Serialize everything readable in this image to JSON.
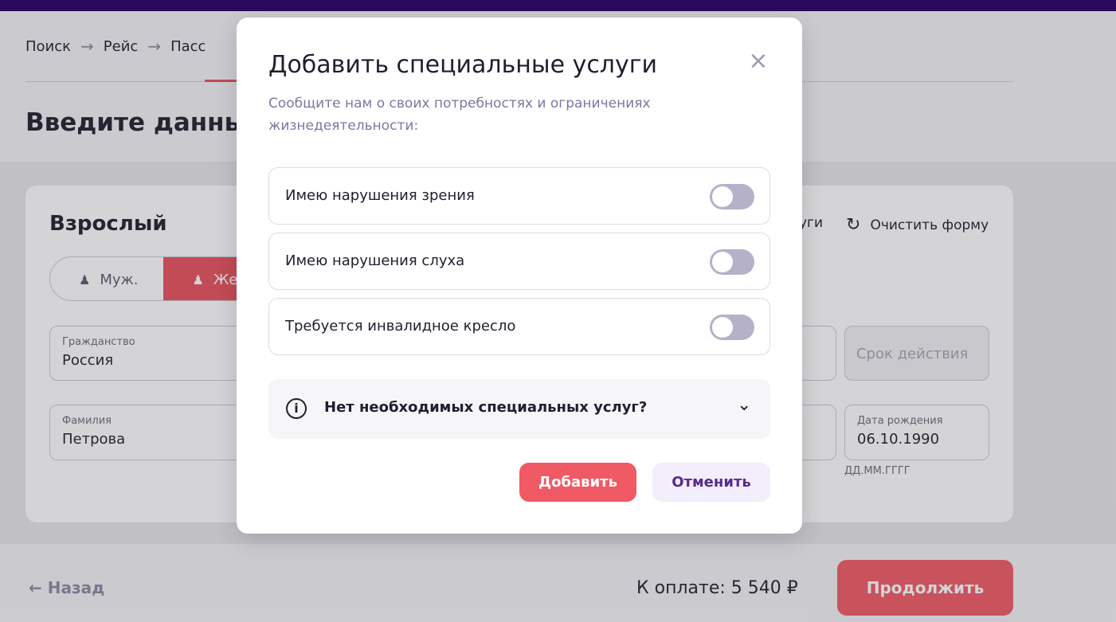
{
  "breadcrumb": {
    "step1": "Поиск",
    "step2": "Рейс",
    "step3": "Пасс",
    "arrow": "→"
  },
  "page": {
    "title": "Введите данные"
  },
  "passenger": {
    "title": "Взрослый",
    "gender": {
      "male": "Муж.",
      "female": "Же"
    },
    "actions": {
      "services_partial": "уги",
      "clear_form": "Очистить форму"
    },
    "fields": {
      "citizenship_label": "Гражданство",
      "citizenship_value": "Россия",
      "expiry_placeholder": "Срок действия",
      "lastname_label": "Фамилия",
      "lastname_value": "Петрова",
      "birthdate_label": "Дата рождения",
      "birthdate_value": "06.10.1990",
      "birthdate_hint": "ДД.ММ.ГГГГ"
    }
  },
  "footer": {
    "back": "← Назад",
    "total": "К оплате: 5 540 ₽",
    "continue": "Продолжить"
  },
  "modal": {
    "title": "Добавить специальные услуги",
    "close": "×",
    "subtitle": "Сообщите нам о своих потребностях и ограничениях жизнедеятельности:",
    "services": [
      {
        "label": "Имею нарушения зрения",
        "enabled": false
      },
      {
        "label": "Имею нарушения слуха",
        "enabled": false
      },
      {
        "label": "Требуется инвалидное кресло",
        "enabled": false
      }
    ],
    "info": {
      "text": "Нет необходимых специальных услуг?",
      "icon": "i"
    },
    "add_button": "Добавить",
    "cancel_button": "Отменить"
  },
  "colors": {
    "accent": "#f05a64",
    "topbar": "#2a0a5c",
    "toggle_off": "#b4b1c8"
  }
}
